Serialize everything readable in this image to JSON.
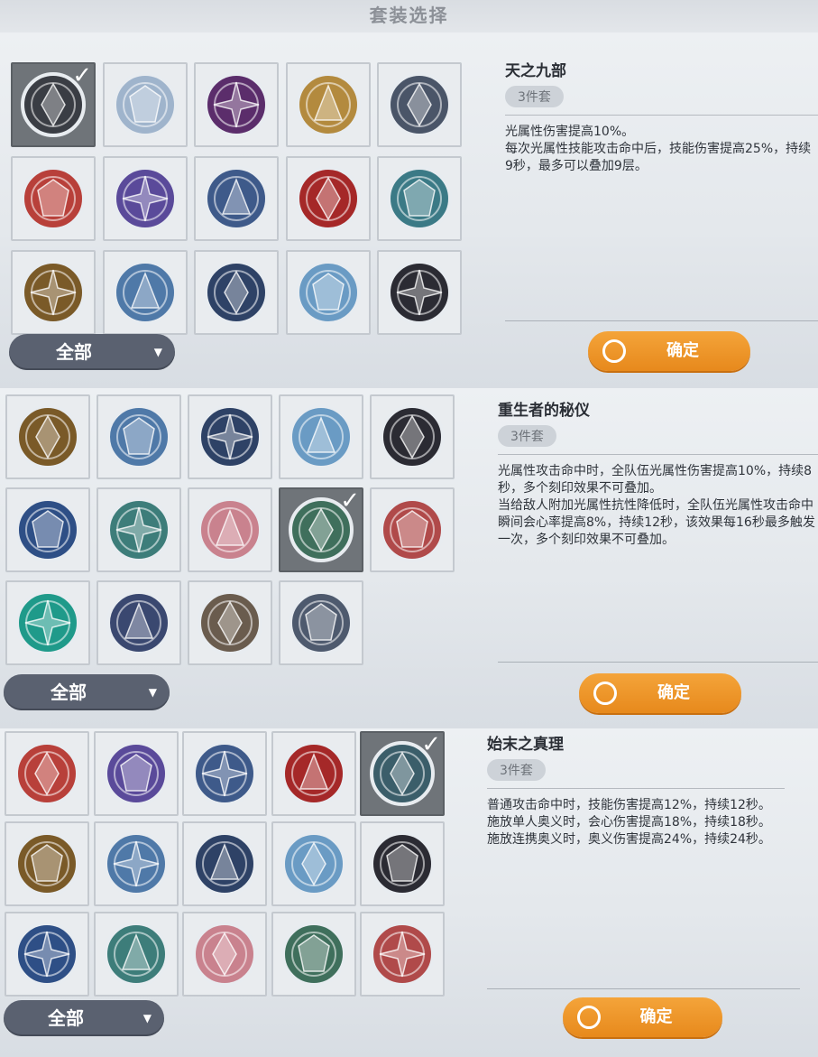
{
  "header": {
    "title": "套装选择"
  },
  "panels": [
    {
      "set_name": "天之九部",
      "set_badge": "3件套",
      "description": "光属性伤害提高10%。\n每次光属性技能攻击命中后，技能伤害提高25%，持续9秒，最多可以叠加9层。",
      "filter_label": "全部",
      "confirm_label": "确定",
      "selected_index": 0,
      "emblems": [
        {
          "icon": "dark-cross-emblem-icon",
          "color": "#3a3d44"
        },
        {
          "icon": "silver-swan-emblem-icon",
          "color": "#9fb4cc"
        },
        {
          "icon": "purple-demon-emblem-icon",
          "color": "#5b2d6b"
        },
        {
          "icon": "golden-dragon-emblem-icon",
          "color": "#b38a3e"
        },
        {
          "icon": "crescent-sword-emblem-icon",
          "color": "#4a5568"
        },
        {
          "icon": "crimson-orbit-emblem-icon",
          "color": "#b8403a"
        },
        {
          "icon": "violet-castle-emblem-icon",
          "color": "#5a4a9a"
        },
        {
          "icon": "blue-compass-emblem-icon",
          "color": "#3e5a8a"
        },
        {
          "icon": "red-flame-crest-emblem-icon",
          "color": "#a52828"
        },
        {
          "icon": "teal-lotus-emblem-icon",
          "color": "#3b7a86"
        },
        {
          "icon": "golden-mask-emblem-icon",
          "color": "#7a5a28"
        },
        {
          "icon": "ice-mountain-emblem-icon",
          "color": "#4f79a8"
        },
        {
          "icon": "wolf-silhouette-emblem-icon",
          "color": "#2e4266"
        },
        {
          "icon": "ice-star-emblem-icon",
          "color": "#6a9bc4"
        },
        {
          "icon": "serpent-pyramid-emblem-icon",
          "color": "#2b2b33"
        }
      ]
    },
    {
      "set_name": "重生者的秘仪",
      "set_badge": "3件套",
      "description": "光属性攻击命中时，全队伍光属性伤害提高10%，持续8秒，多个刻印效果不可叠加。\n当给敌人附加光属性抗性降低时，全队伍光属性攻击命中瞬间会心率提高8%，持续12秒，该效果每16秒最多触发一次，多个刻印效果不可叠加。",
      "filter_label": "全部",
      "confirm_label": "确定",
      "selected_index": 8,
      "emblems": [
        {
          "icon": "golden-mask-emblem-icon",
          "color": "#7a5a28"
        },
        {
          "icon": "ice-mountain-emblem-icon",
          "color": "#4f79a8"
        },
        {
          "icon": "wolf-silhouette-emblem-icon",
          "color": "#2e4266"
        },
        {
          "icon": "ice-star-emblem-icon",
          "color": "#6a9bc4"
        },
        {
          "icon": "serpent-pyramid-emblem-icon",
          "color": "#2b2b33"
        },
        {
          "icon": "blue-knight-crest-emblem-icon",
          "color": "#2e4f86"
        },
        {
          "icon": "teal-dragon-emblem-icon",
          "color": "#3d7d7a"
        },
        {
          "icon": "pink-swirl-blades-emblem-icon",
          "color": "#c9828e"
        },
        {
          "icon": "pharaoh-emblem-icon",
          "color": "#3f6f5c"
        },
        {
          "icon": "red-crossed-swords-emblem-icon",
          "color": "#b04a4a"
        },
        {
          "icon": "teal-pinwheel-emblem-icon",
          "color": "#1f9a8a"
        },
        {
          "icon": "scorpion-emblem-icon",
          "color": "#3a4870"
        },
        {
          "icon": "bronze-claw-emblem-icon",
          "color": "#6a5c4e"
        },
        {
          "icon": "silver-temple-emblem-icon",
          "color": "#4e5a6e"
        }
      ]
    },
    {
      "set_name": "始末之真理",
      "set_badge": "3件套",
      "description": "普通攻击命中时，技能伤害提高12%，持续12秒。\n施放单人奥义时，会心伤害提高18%，持续18秒。\n施放连携奥义时，奥义伤害提高24%，持续24秒。",
      "filter_label": "全部",
      "confirm_label": "确定",
      "selected_index": 4,
      "emblems": [
        {
          "icon": "crimson-orbit-emblem-icon",
          "color": "#b8403a"
        },
        {
          "icon": "violet-castle-emblem-icon",
          "color": "#5a4a9a"
        },
        {
          "icon": "blue-compass-emblem-icon",
          "color": "#3e5a8a"
        },
        {
          "icon": "red-flame-crest-emblem-icon",
          "color": "#a52828"
        },
        {
          "icon": "teal-lotus-emblem-icon",
          "color": "#3b5e6a"
        },
        {
          "icon": "golden-mask-emblem-icon",
          "color": "#7a5a28"
        },
        {
          "icon": "ice-mountain-emblem-icon",
          "color": "#4f79a8"
        },
        {
          "icon": "wolf-silhouette-emblem-icon",
          "color": "#2e4266"
        },
        {
          "icon": "ice-star-emblem-icon",
          "color": "#6a9bc4"
        },
        {
          "icon": "serpent-pyramid-emblem-icon",
          "color": "#2b2b33"
        },
        {
          "icon": "blue-knight-crest-emblem-icon",
          "color": "#2e4f86"
        },
        {
          "icon": "teal-dragon-emblem-icon",
          "color": "#3d7d7a"
        },
        {
          "icon": "pink-swirl-blades-emblem-icon",
          "color": "#c9828e"
        },
        {
          "icon": "pharaoh-emblem-icon",
          "color": "#3f6f5c"
        },
        {
          "icon": "red-crossed-swords-emblem-icon",
          "color": "#b04a4a"
        }
      ]
    }
  ]
}
